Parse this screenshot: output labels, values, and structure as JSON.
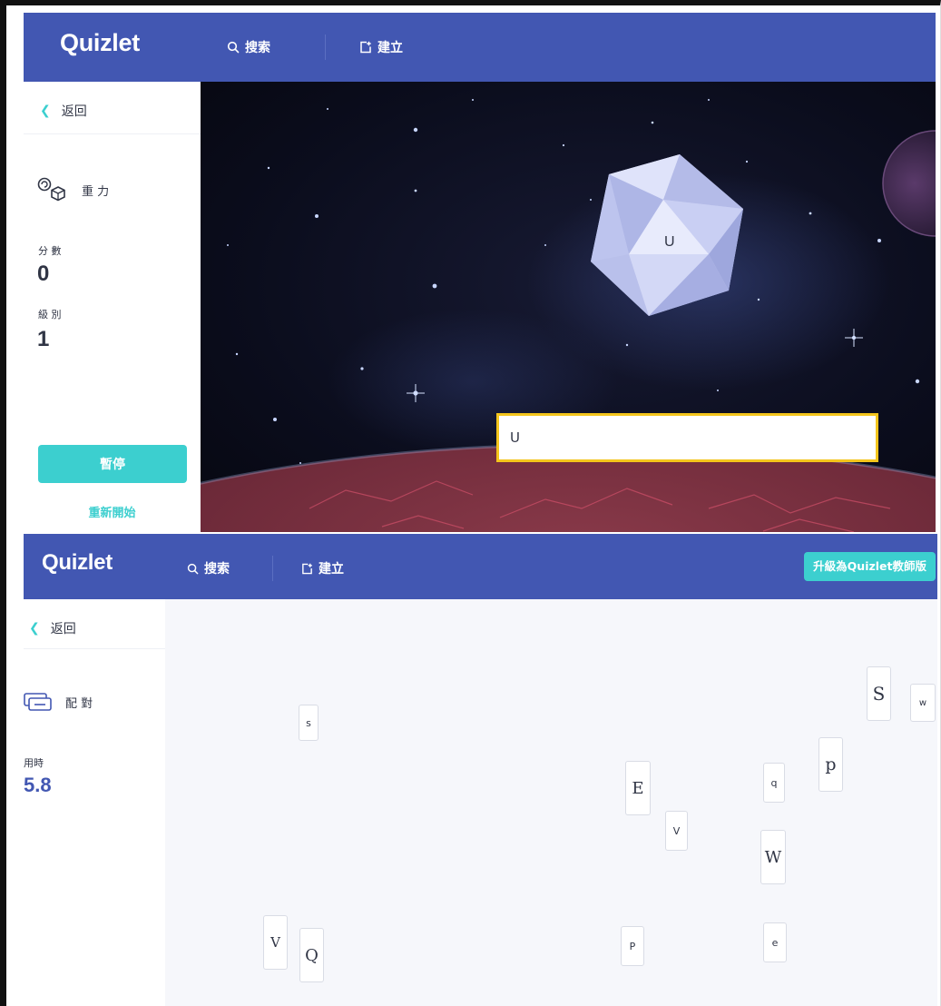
{
  "gravity": {
    "header": {
      "logo": "Quizlet",
      "search_label": "搜索",
      "create_label": "建立"
    },
    "sidebar": {
      "back_label": "返回",
      "mode_label": "重 力",
      "score_label": "分 數",
      "score_value": "0",
      "level_label": "級 別",
      "level_value": "1",
      "pause_label": "暫停",
      "restart_label": "重新開始"
    },
    "game": {
      "falling_term": "U",
      "answer_input_value": "U"
    }
  },
  "match": {
    "header": {
      "logo": "Quizlet",
      "search_label": "搜索",
      "create_label": "建立",
      "upgrade_label": "升級為Quizlet教師版"
    },
    "sidebar": {
      "back_label": "返回",
      "mode_label": "配 對",
      "time_label": "用時",
      "time_value": "5.8"
    },
    "tiles": [
      {
        "text": "s"
      },
      {
        "text": "S"
      },
      {
        "text": "w"
      },
      {
        "text": "p"
      },
      {
        "text": "E"
      },
      {
        "text": "q"
      },
      {
        "text": "V"
      },
      {
        "text": "W"
      },
      {
        "text": "V"
      },
      {
        "text": "Q"
      },
      {
        "text": "P"
      },
      {
        "text": "e"
      }
    ]
  },
  "colors": {
    "brand": "#4257b2",
    "accent": "#3ccfcf",
    "input_focus": "#f4c51c"
  },
  "icons": {
    "search": "search-icon",
    "create": "create-icon",
    "back": "chevron-left-icon",
    "gravity_mode": "gravity-icon",
    "match_mode": "match-icon"
  }
}
